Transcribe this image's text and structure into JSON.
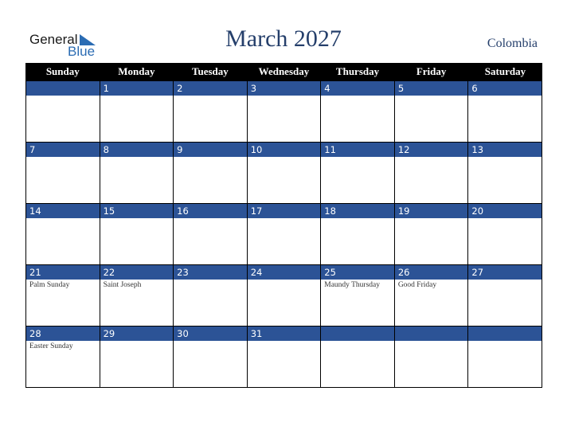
{
  "brand": {
    "line1": "General",
    "line2": "Blue"
  },
  "header": {
    "title": "March 2027",
    "country": "Colombia"
  },
  "weekdays": [
    "Sunday",
    "Monday",
    "Tuesday",
    "Wednesday",
    "Thursday",
    "Friday",
    "Saturday"
  ],
  "weeks": [
    [
      {
        "day": "",
        "event": ""
      },
      {
        "day": "1",
        "event": ""
      },
      {
        "day": "2",
        "event": ""
      },
      {
        "day": "3",
        "event": ""
      },
      {
        "day": "4",
        "event": ""
      },
      {
        "day": "5",
        "event": ""
      },
      {
        "day": "6",
        "event": ""
      }
    ],
    [
      {
        "day": "7",
        "event": ""
      },
      {
        "day": "8",
        "event": ""
      },
      {
        "day": "9",
        "event": ""
      },
      {
        "day": "10",
        "event": ""
      },
      {
        "day": "11",
        "event": ""
      },
      {
        "day": "12",
        "event": ""
      },
      {
        "day": "13",
        "event": ""
      }
    ],
    [
      {
        "day": "14",
        "event": ""
      },
      {
        "day": "15",
        "event": ""
      },
      {
        "day": "16",
        "event": ""
      },
      {
        "day": "17",
        "event": ""
      },
      {
        "day": "18",
        "event": ""
      },
      {
        "day": "19",
        "event": ""
      },
      {
        "day": "20",
        "event": ""
      }
    ],
    [
      {
        "day": "21",
        "event": "Palm Sunday"
      },
      {
        "day": "22",
        "event": "Saint Joseph"
      },
      {
        "day": "23",
        "event": ""
      },
      {
        "day": "24",
        "event": ""
      },
      {
        "day": "25",
        "event": "Maundy Thursday"
      },
      {
        "day": "26",
        "event": "Good Friday"
      },
      {
        "day": "27",
        "event": ""
      }
    ],
    [
      {
        "day": "28",
        "event": "Easter Sunday"
      },
      {
        "day": "29",
        "event": ""
      },
      {
        "day": "30",
        "event": ""
      },
      {
        "day": "31",
        "event": ""
      },
      {
        "day": "",
        "event": ""
      },
      {
        "day": "",
        "event": ""
      },
      {
        "day": "",
        "event": ""
      }
    ]
  ],
  "colors": {
    "header_bg": "#000000",
    "daynum_bg": "#2c5396",
    "title": "#253f6b",
    "brand_blue": "#2b6cb3"
  }
}
